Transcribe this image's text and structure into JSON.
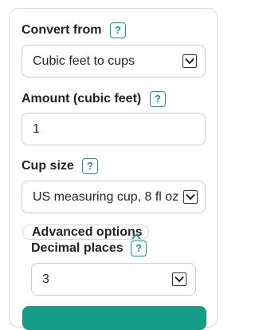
{
  "convert_from": {
    "label": "Convert from",
    "help": "?",
    "selected": "Cubic feet to cups"
  },
  "amount": {
    "label": "Amount (cubic feet)",
    "help": "?",
    "value": "1"
  },
  "cup_size": {
    "label": "Cup size",
    "help": "?",
    "selected": "US measuring cup, 8 fl oz"
  },
  "advanced": {
    "label": "Advanced options"
  },
  "decimal_places": {
    "label": "Decimal places",
    "help": "?",
    "selected": "3"
  },
  "colors": {
    "accent": "#169c87",
    "border": "#c9cdd1",
    "text": "#1f2328"
  }
}
